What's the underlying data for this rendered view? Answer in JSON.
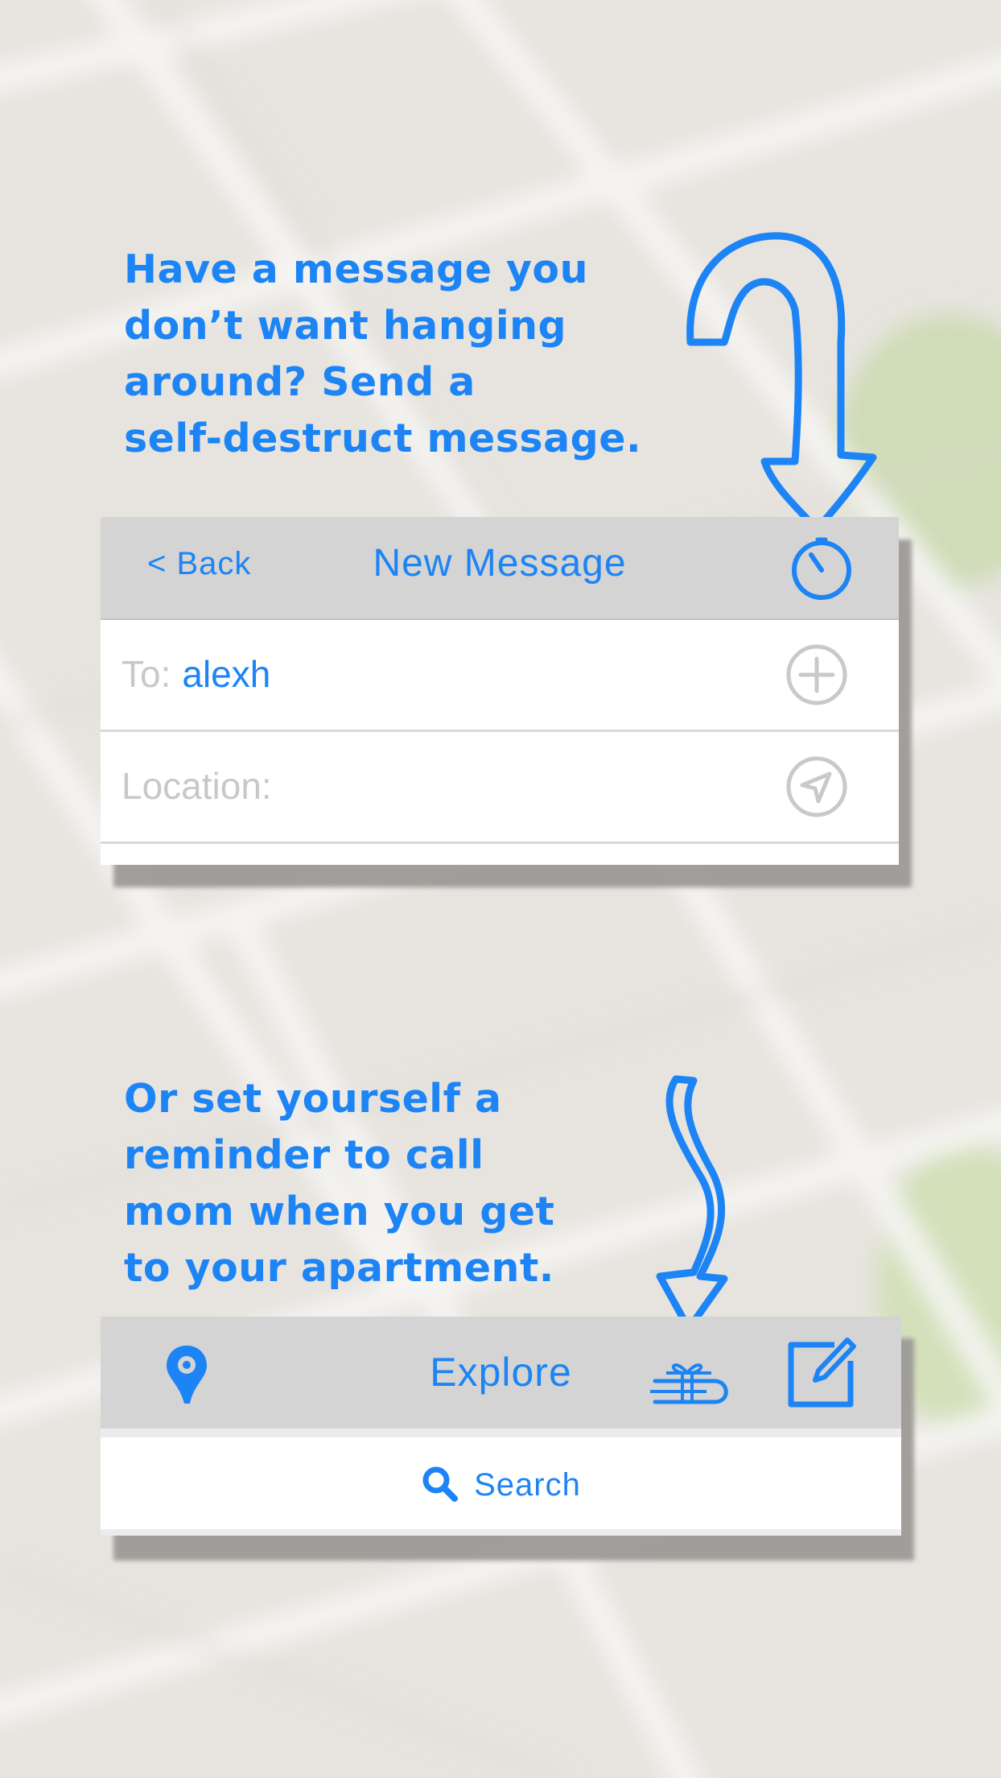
{
  "theme": {
    "accent": "#1d84f5",
    "nav_bg": "#d4d4d4",
    "muted_text": "#c8c8c8"
  },
  "promo": {
    "caption_1": [
      "Have a message you",
      "don’t want hanging",
      "around? Send a",
      "self-destruct message."
    ],
    "caption_2": [
      "Or set yourself a",
      "reminder to call",
      "mom when you get",
      "to your apartment."
    ]
  },
  "new_message": {
    "back_label": "< Back",
    "title": "New Message",
    "timer_icon": "timer-icon",
    "to_label": "To:",
    "to_value": "alexh",
    "to_action_icon": "plus-circle-icon",
    "location_label": "Location:",
    "location_action_icon": "location-arrow-icon"
  },
  "explore": {
    "title": "Explore",
    "pin_icon": "map-pin-icon",
    "gift_icon": "gift-icon",
    "compose_icon": "compose-icon",
    "search_label": "Search",
    "search_icon": "search-icon"
  }
}
